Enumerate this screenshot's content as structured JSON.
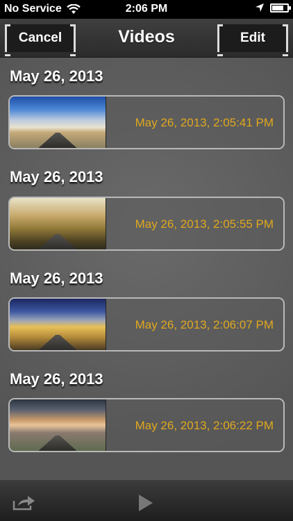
{
  "status": {
    "carrier": "No Service",
    "time": "2:06 PM",
    "battery_level": 0.75
  },
  "nav": {
    "title": "Videos",
    "cancel_label": "Cancel",
    "edit_label": "Edit"
  },
  "sections": [
    {
      "header": "May 26, 2013",
      "item": "May 26, 2013, 2:05:41 PM"
    },
    {
      "header": "May 26, 2013",
      "item": "May 26, 2013, 2:05:55 PM"
    },
    {
      "header": "May 26, 2013",
      "item": "May 26, 2013, 2:06:07 PM"
    },
    {
      "header": "May 26, 2013",
      "item": "May 26, 2013, 2:06:22 PM"
    }
  ],
  "toolbar": {
    "icons": [
      "share-icon",
      "play-icon"
    ]
  },
  "colors": {
    "accent_text": "#e0a81e",
    "nav_background": "#2b2b2b"
  }
}
